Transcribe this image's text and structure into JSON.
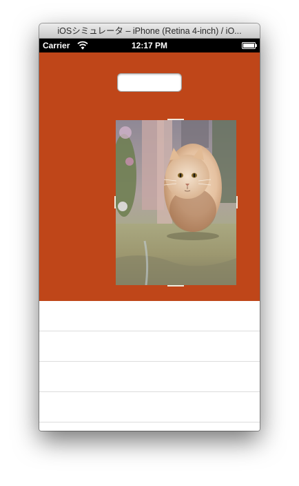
{
  "window": {
    "title": "iOSシミュレータ – iPhone (Retina 4-inch) / iO..."
  },
  "status_bar": {
    "carrier": "Carrier",
    "time": "12:17 PM",
    "wifi_icon": "wifi-icon",
    "battery_icon": "battery-icon"
  },
  "main_view": {
    "background_color": "#bf4619",
    "text_field": {
      "value": "",
      "placeholder": ""
    },
    "image_view": {
      "subject": "cat-photo"
    }
  },
  "table_view": {
    "rows": [
      {
        "label": ""
      },
      {
        "label": ""
      },
      {
        "label": ""
      },
      {
        "label": ""
      }
    ]
  }
}
